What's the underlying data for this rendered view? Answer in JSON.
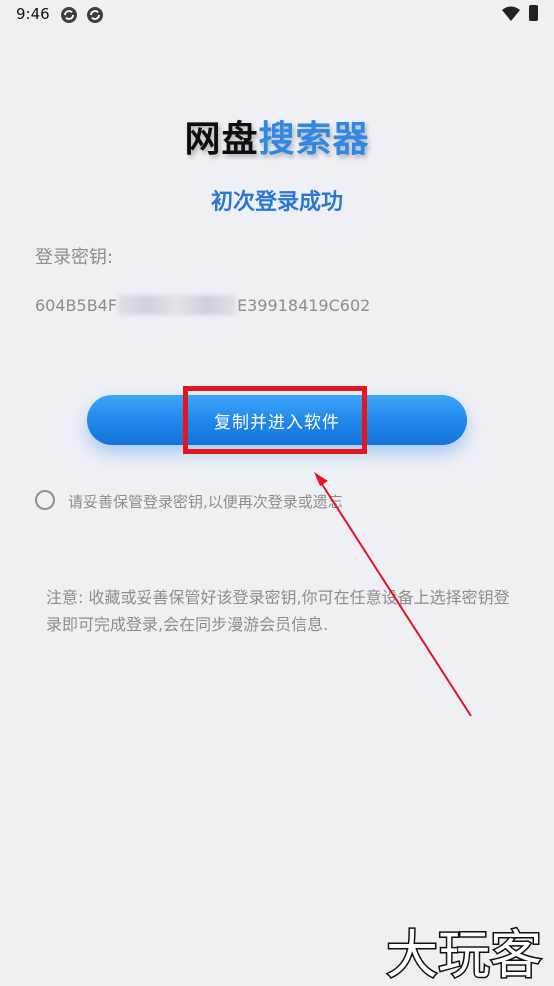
{
  "status_bar": {
    "time": "9:46",
    "icons": [
      "sync-icon",
      "sync-icon",
      "wifi-icon",
      "battery-icon"
    ]
  },
  "header": {
    "title_part1": "网盘",
    "title_part2": "搜索器",
    "subtitle": "初次登录成功"
  },
  "login_key": {
    "label": "登录密钥:",
    "value_prefix": "604B5B4F",
    "value_suffix": "E39918419C602"
  },
  "actions": {
    "copy_enter_label": "复制并进入软件"
  },
  "option": {
    "remember_label": "请妥善保管登录密钥,以便再次登录或遗忘",
    "checked": false
  },
  "notice": {
    "text": "注意: 收藏或妥善保管好该登录密钥,你可在任意设备上选择密钥登录即可完成登录,会在同步漫游会员信息."
  },
  "watermark": {
    "text": "大玩客"
  },
  "colors": {
    "background": "#eef0f5",
    "accent": "#2f87e6",
    "button": "#1f86ea",
    "highlight": "#e4151f",
    "text_muted": "#8d8d8d"
  }
}
